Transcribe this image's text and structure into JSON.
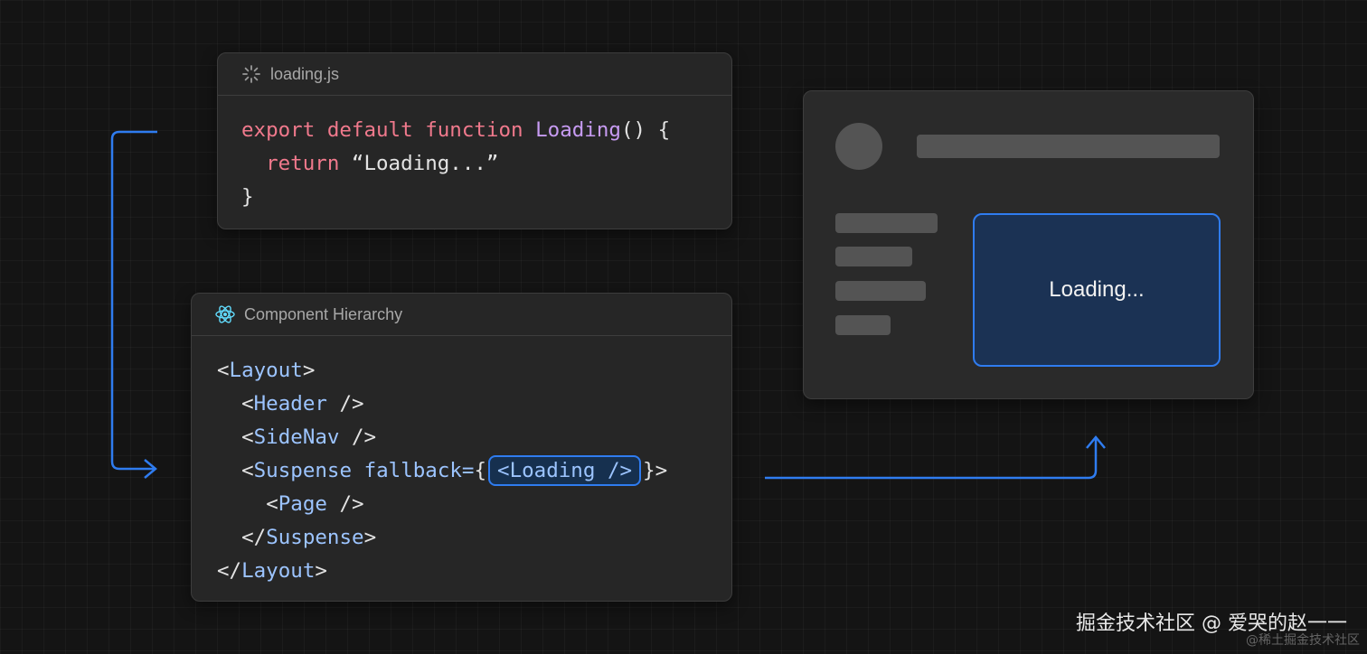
{
  "loading_panel": {
    "filename": "loading.js",
    "code": {
      "l1_export": "export",
      "l1_default": "default",
      "l1_function": "function",
      "l1_name": "Loading",
      "l1_rest": "() {",
      "l2_return": "return",
      "l2_string": "“Loading...”",
      "l3": "}"
    }
  },
  "hierarchy_panel": {
    "title": "Component Hierarchy",
    "code": {
      "lt": "<",
      "gt": ">",
      "selfclose": " />",
      "closelt": "</",
      "layout": "Layout",
      "header": "Header",
      "sidenav": "SideNav",
      "suspense": "Suspense",
      "fallback": "fallback=",
      "brace_open": "{",
      "loading_tag": "<Loading />",
      "brace_close": "}>",
      "page": "Page"
    }
  },
  "preview": {
    "loading_text": "Loading..."
  },
  "watermark": {
    "main": "掘金技术社区 @ 爱哭的赵一一",
    "sub": "@稀土掘金技术社区"
  },
  "colors": {
    "accent": "#2f7cf0",
    "keyword": "#f0798c",
    "function": "#c79bf2",
    "tag": "#9cc4ff"
  }
}
